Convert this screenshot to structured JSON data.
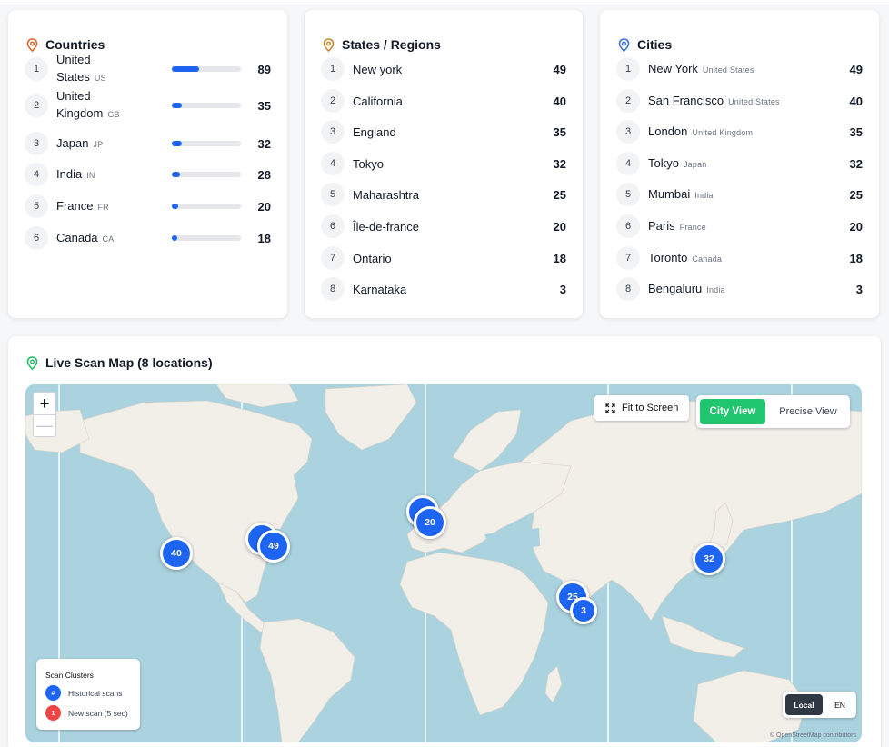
{
  "countries": {
    "title": "Countries",
    "items": [
      {
        "rank": "1",
        "name": "United States",
        "code": "US",
        "count": "89",
        "share": 0.4
      },
      {
        "rank": "2",
        "name": "United Kingdom",
        "code": "GB",
        "count": "35",
        "share": 0.15
      },
      {
        "rank": "3",
        "name": "Japan",
        "code": "JP",
        "count": "32",
        "share": 0.14
      },
      {
        "rank": "4",
        "name": "India",
        "code": "IN",
        "count": "28",
        "share": 0.12
      },
      {
        "rank": "5",
        "name": "France",
        "code": "FR",
        "count": "20",
        "share": 0.09
      },
      {
        "rank": "6",
        "name": "Canada",
        "code": "CA",
        "count": "18",
        "share": 0.08
      }
    ]
  },
  "states": {
    "title": "States / Regions",
    "items": [
      {
        "rank": "1",
        "name": "New york",
        "count": "49"
      },
      {
        "rank": "2",
        "name": "California",
        "count": "40"
      },
      {
        "rank": "3",
        "name": "England",
        "count": "35"
      },
      {
        "rank": "4",
        "name": "Tokyo",
        "count": "32"
      },
      {
        "rank": "5",
        "name": "Maharashtra",
        "count": "25"
      },
      {
        "rank": "6",
        "name": "Île-de-france",
        "count": "20"
      },
      {
        "rank": "7",
        "name": "Ontario",
        "count": "18"
      },
      {
        "rank": "8",
        "name": "Karnataka",
        "count": "3"
      }
    ]
  },
  "cities": {
    "title": "Cities",
    "items": [
      {
        "rank": "1",
        "name": "New York",
        "country": "United States",
        "count": "49"
      },
      {
        "rank": "2",
        "name": "San Francisco",
        "country": "United States",
        "count": "40"
      },
      {
        "rank": "3",
        "name": "London",
        "country": "United Kingdom",
        "count": "35"
      },
      {
        "rank": "4",
        "name": "Tokyo",
        "country": "Japan",
        "count": "32"
      },
      {
        "rank": "5",
        "name": "Mumbai",
        "country": "India",
        "count": "25"
      },
      {
        "rank": "6",
        "name": "Paris",
        "country": "France",
        "count": "20"
      },
      {
        "rank": "7",
        "name": "Toronto",
        "country": "Canada",
        "count": "18"
      },
      {
        "rank": "8",
        "name": "Bengaluru",
        "country": "India",
        "count": "3"
      }
    ]
  },
  "map": {
    "title": "Live Scan Map (8 locations)",
    "zoom_in": "+",
    "zoom_out": "—",
    "fit_label": "Fit to Screen",
    "city_view_label": "City View",
    "precise_view_label": "Precise View",
    "clusters": [
      {
        "label": "40",
        "city": "San Francisco"
      },
      {
        "label": "",
        "city": "Toronto"
      },
      {
        "label": "49",
        "city": "New York"
      },
      {
        "label": "",
        "city": "London"
      },
      {
        "label": "20",
        "city": "Paris"
      },
      {
        "label": "25",
        "city": "Mumbai"
      },
      {
        "label": "3",
        "city": "Bengaluru"
      },
      {
        "label": "32",
        "city": "Tokyo"
      }
    ],
    "legend": {
      "title": "Scan Clusters",
      "historical_symbol": "#",
      "historical_label": "Historical scans",
      "new_symbol": "1",
      "new_label": "New scan (5 sec)"
    },
    "lang_local": "Local",
    "lang_en": "EN",
    "attribution": "© OpenStreetMap contributors"
  },
  "colors": {
    "accent_blue": "#1d64f2",
    "green": "#1fc56f",
    "new_scan_red": "#ef4444",
    "water": "#aad3df",
    "land": "#f2efe9"
  },
  "icons": {
    "countries": "map-pin-icon",
    "states": "map-pin-icon",
    "cities": "map-pin-icon",
    "map": "map-pin-icon",
    "fit": "expand-icon"
  }
}
